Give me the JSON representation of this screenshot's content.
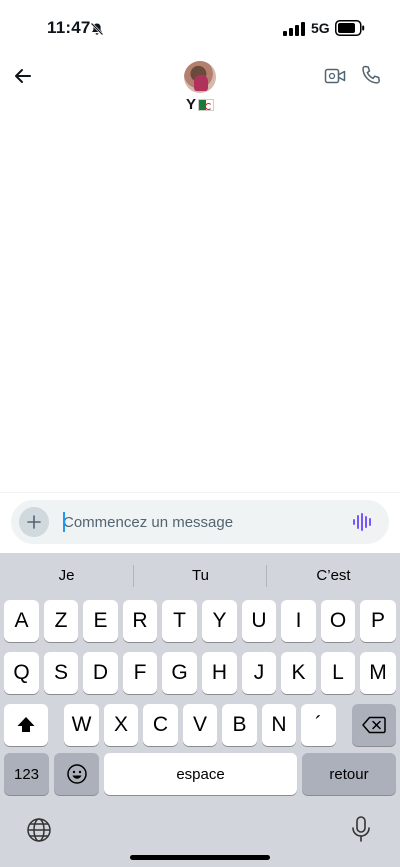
{
  "status_bar": {
    "time": "11:47",
    "network": "5G",
    "icons": [
      "bell-muted-icon",
      "signal-icon",
      "battery-icon"
    ]
  },
  "header": {
    "contact_name": "Y",
    "flag": "algeria-flag",
    "actions": [
      "back-arrow-icon",
      "video-call-icon",
      "phone-icon"
    ]
  },
  "composer": {
    "placeholder": "Commencez un message",
    "value": "",
    "icons": [
      "plus-icon",
      "voice-message-icon"
    ]
  },
  "keyboard": {
    "suggestions": [
      "Je",
      "Tu",
      "C’est"
    ],
    "row1": [
      "A",
      "Z",
      "E",
      "R",
      "T",
      "Y",
      "U",
      "I",
      "O",
      "P"
    ],
    "row2": [
      "Q",
      "S",
      "D",
      "F",
      "G",
      "H",
      "J",
      "K",
      "L",
      "M"
    ],
    "row3": [
      "W",
      "X",
      "C",
      "V",
      "B",
      "N",
      "´"
    ],
    "numbers_label": "123",
    "space_label": "espace",
    "return_label": "retour"
  },
  "colors": {
    "accent": "#1d9bf0",
    "voice_icon": "#7856ff",
    "keyboard_bg": "#d3d5dc",
    "composer_bg": "#eff3f4"
  }
}
